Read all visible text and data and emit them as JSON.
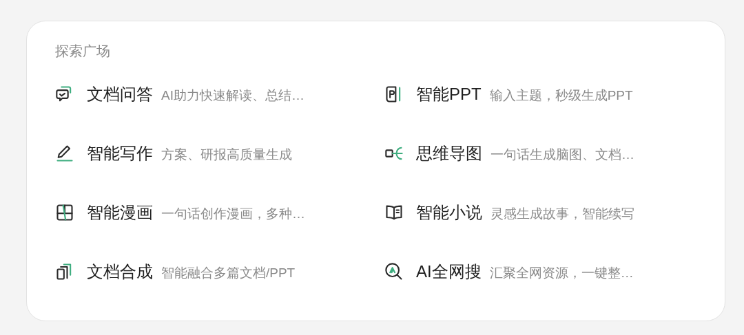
{
  "section_title": "探索广场",
  "items": [
    {
      "kind": "doc-qa",
      "title": "文档问答",
      "description": "AI助力快速解读、总结…"
    },
    {
      "kind": "ppt",
      "title": "智能PPT",
      "description": "输入主题，秒级生成PPT"
    },
    {
      "kind": "writing",
      "title": "智能写作",
      "description": "方案、研报高质量生成"
    },
    {
      "kind": "mindmap",
      "title": "思维导图",
      "description": "一句话生成脑图、文档…"
    },
    {
      "kind": "comic",
      "title": "智能漫画",
      "description": "一句话创作漫画，多种…"
    },
    {
      "kind": "novel",
      "title": "智能小说",
      "description": "灵感生成故事，智能续写"
    },
    {
      "kind": "merge",
      "title": "文档合成",
      "description": "智能融合多篇文档/PPT"
    },
    {
      "kind": "search",
      "title": "AI全网搜",
      "description": "汇聚全网资源，一键整…"
    }
  ]
}
